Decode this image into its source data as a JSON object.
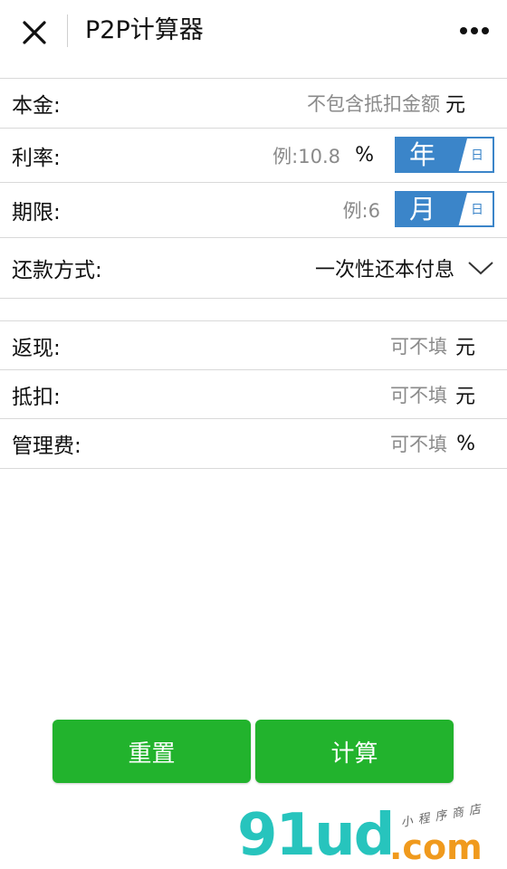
{
  "header": {
    "title": "P2P计算器"
  },
  "form": {
    "principal": {
      "label": "本金:",
      "placeholder": "不包含抵扣金额",
      "unit": "元"
    },
    "rate": {
      "label": "利率:",
      "placeholder": "例:10.8",
      "unit": "%",
      "toggle_active": "年",
      "toggle_inactive": "日"
    },
    "term": {
      "label": "期限:",
      "placeholder": "例:6",
      "toggle_active": "月",
      "toggle_inactive": "日"
    },
    "repayment": {
      "label": "还款方式:",
      "value": "一次性还本付息"
    },
    "cashback": {
      "label": "返现:",
      "placeholder": "可不填",
      "unit": "元"
    },
    "deduction": {
      "label": "抵扣:",
      "placeholder": "可不填",
      "unit": "元"
    },
    "fee": {
      "label": "管理费:",
      "placeholder": "可不填",
      "unit": "%"
    }
  },
  "buttons": {
    "reset": "重置",
    "calculate": "计算"
  },
  "watermark": {
    "main": "91ud",
    "suffix": ".com",
    "small": "小程序商店"
  },
  "colors": {
    "accent_blue": "#3b85c9",
    "button_green": "#22b32d",
    "watermark_teal": "#27c4bd",
    "watermark_orange": "#f09a1d"
  }
}
